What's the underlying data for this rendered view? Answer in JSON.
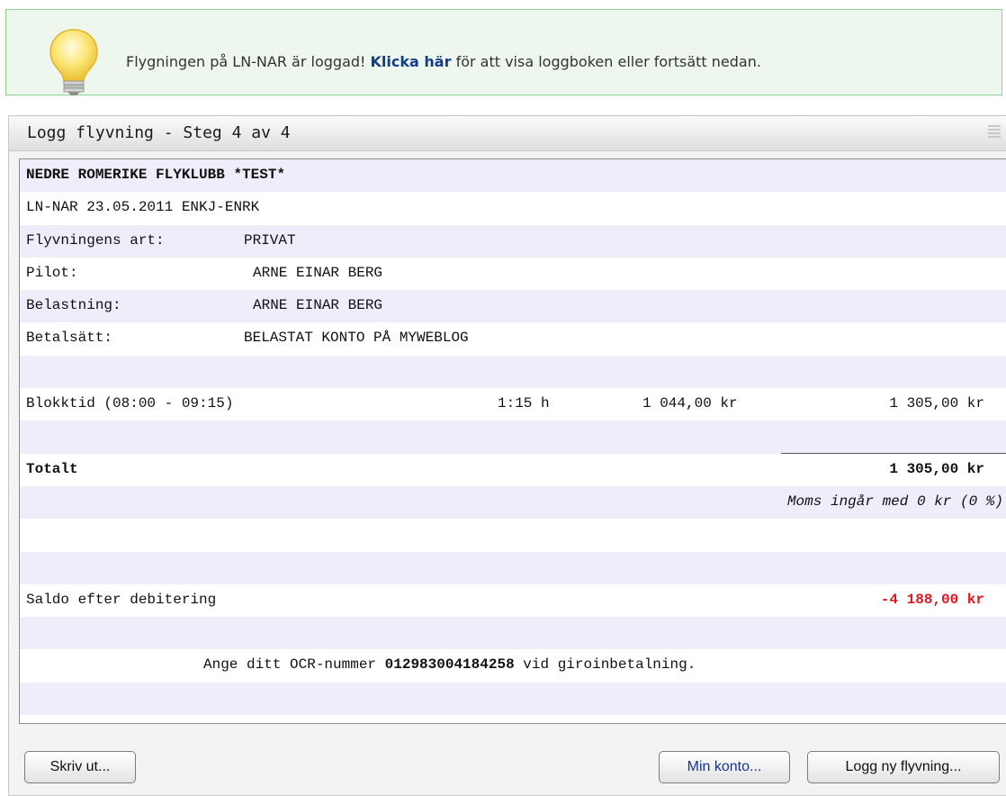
{
  "notice": {
    "text_before": "Flygningen på LN-NAR är loggad!",
    "link": "Klicka här",
    "text_after": "för att visa loggboken eller fortsätt nedan.",
    "icon": "lightbulb-icon"
  },
  "panel": {
    "title": "Logg flyvning - Steg 4 av 4"
  },
  "receipt": {
    "club": "NEDRE ROMERIKE FLYKLUBB *TEST*",
    "flight": "LN-NAR 23.05.2011 ENKJ-ENRK",
    "fields": [
      {
        "label": "Flyvningens art:",
        "value": "PRIVAT"
      },
      {
        "label": "Pilot:",
        "value": "ARNE EINAR BERG"
      },
      {
        "label": "Belastning:",
        "value": "ARNE EINAR BERG"
      },
      {
        "label": "Betalsätt:",
        "value": "BELASTAT KONTO PÅ MYWEBLOG"
      }
    ],
    "line_item": {
      "label": "Blokktid (08:00 - 09:15)",
      "time": "1:15 h",
      "rate": "1 044,00 kr",
      "amount": "1 305,00 kr"
    },
    "total_label": "Totalt",
    "total_value": "1 305,00",
    "total_unit": "kr",
    "vat_note": "Moms ingår med 0 kr (0 %)",
    "balance_label": "Saldo efter debitering",
    "balance_value": "-4 188,00 kr",
    "ocr_before": "Ange ditt OCR-nummer",
    "ocr_number": "012983004184258",
    "ocr_after": "vid giroinbetalning."
  },
  "buttons": {
    "print": "Skriv ut...",
    "account": "Min konto...",
    "new_flight": "Logg ny flyvning..."
  },
  "colors": {
    "notice_bg": "#eef7ee",
    "notice_border": "#8fcf8f",
    "link": "#153c8a",
    "row_alt": "#eeeefa",
    "negative": "#e1171f"
  }
}
